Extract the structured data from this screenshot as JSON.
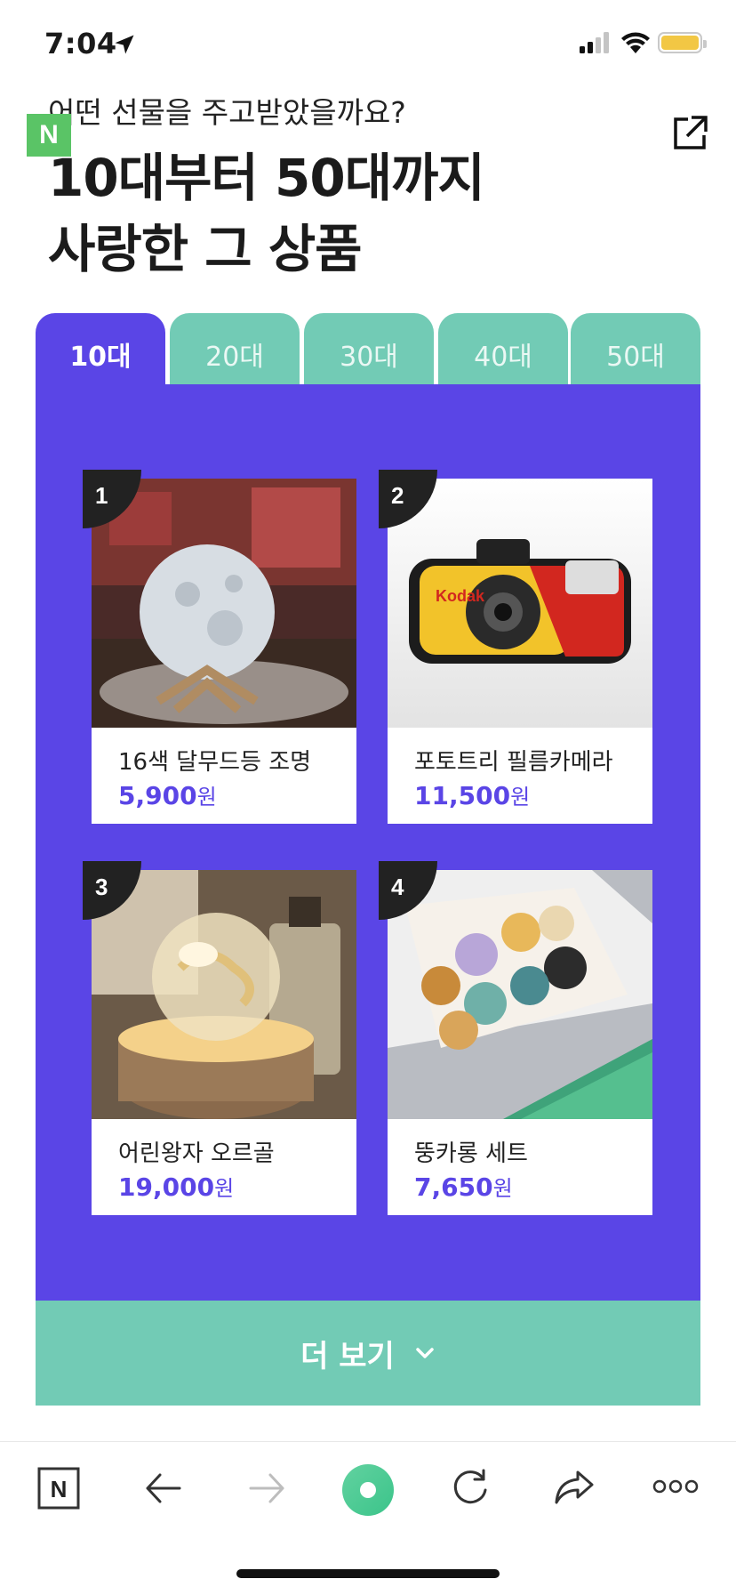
{
  "status_bar": {
    "time": "7:04"
  },
  "header": {
    "badge": "N",
    "subtitle": "어떤 선물을 주고받았을까요?",
    "title_line1": "10대부터 50대까지",
    "title_line2": "사랑한 그 상품"
  },
  "tabs": [
    {
      "label": "10대",
      "active": true
    },
    {
      "label": "20대",
      "active": false
    },
    {
      "label": "30대",
      "active": false
    },
    {
      "label": "40대",
      "active": false
    },
    {
      "label": "50대",
      "active": false
    }
  ],
  "products": [
    {
      "rank": "1",
      "name": "16색 달무드등 조명",
      "price": "5,900",
      "unit": "원"
    },
    {
      "rank": "2",
      "name": "포토트리 필름카메라",
      "price": "11,500",
      "unit": "원",
      "brand": "Kodak"
    },
    {
      "rank": "3",
      "name": "어린왕자 오르골",
      "price": "19,000",
      "unit": "원"
    },
    {
      "rank": "4",
      "name": "뚱카롱 세트",
      "price": "7,650",
      "unit": "원"
    }
  ],
  "more_button": {
    "label": "더 보기"
  },
  "toolbar": {
    "home": "N",
    "icons": [
      "naver-home-icon",
      "back-arrow-icon",
      "forward-arrow-icon",
      "green-dot-icon",
      "refresh-icon",
      "share-icon",
      "more-icon"
    ]
  },
  "colors": {
    "accent": "#5a45e6",
    "mint": "#72cbb5",
    "naver_green": "#5ac466"
  }
}
